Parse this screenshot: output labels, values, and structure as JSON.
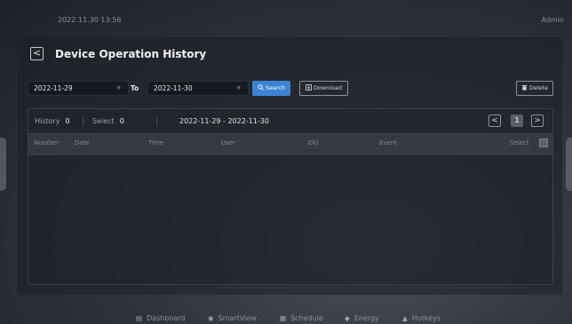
{
  "status_bar": {
    "datetime": "2022.11.30  13:56",
    "user": "Admin"
  },
  "page": {
    "title": "Device Operation History",
    "back_glyph": "<"
  },
  "filters": {
    "start_date": "2022-11-29",
    "end_date": "2022-11-30",
    "to_label": "To",
    "caret_glyph": "▼",
    "search_label": "Search",
    "download_label": "Download",
    "delete_label": "Delete"
  },
  "summary": {
    "history_label": "History",
    "history_count": "0",
    "select_label": "Select",
    "select_count": "0",
    "date_range": "2022-11-29 - 2022-11-30"
  },
  "pagination": {
    "prev_glyph": "<",
    "current_page": "1",
    "next_glyph": ">"
  },
  "table": {
    "columns": [
      "Number",
      "Date",
      "Time",
      "User",
      "IDU",
      "Event",
      "Select"
    ],
    "rows": []
  },
  "bottom_nav": {
    "items": [
      {
        "label": "Dashboard",
        "icon": "dashboard-icon"
      },
      {
        "label": "SmartView",
        "icon": "smartview-icon"
      },
      {
        "label": "Schedule",
        "icon": "schedule-icon"
      },
      {
        "label": "Energy",
        "icon": "energy-icon"
      },
      {
        "label": "Hotkeys",
        "icon": "hotkeys-icon"
      }
    ]
  },
  "colors": {
    "accent": "#3c84d4",
    "background": "#2b2e35",
    "text": "#c9ccd3"
  }
}
